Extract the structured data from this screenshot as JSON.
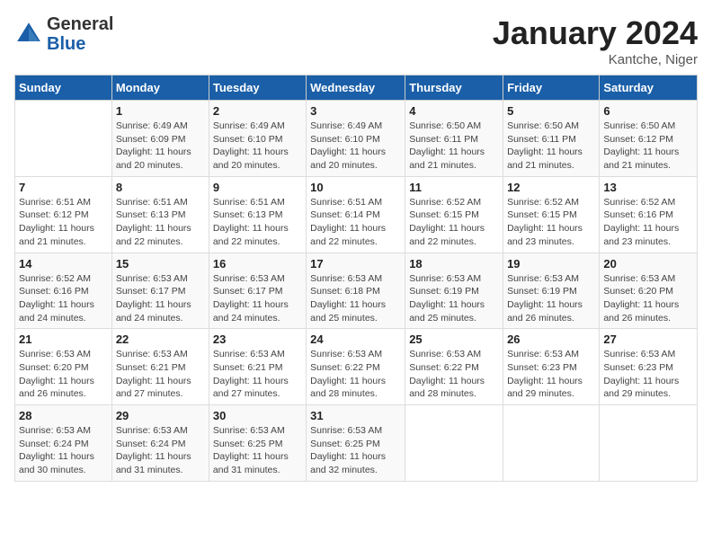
{
  "header": {
    "logo_general": "General",
    "logo_blue": "Blue",
    "month_title": "January 2024",
    "subtitle": "Kantche, Niger"
  },
  "columns": [
    "Sunday",
    "Monday",
    "Tuesday",
    "Wednesday",
    "Thursday",
    "Friday",
    "Saturday"
  ],
  "weeks": [
    [
      {
        "day": "",
        "info": ""
      },
      {
        "day": "1",
        "info": "Sunrise: 6:49 AM\nSunset: 6:09 PM\nDaylight: 11 hours\nand 20 minutes."
      },
      {
        "day": "2",
        "info": "Sunrise: 6:49 AM\nSunset: 6:10 PM\nDaylight: 11 hours\nand 20 minutes."
      },
      {
        "day": "3",
        "info": "Sunrise: 6:49 AM\nSunset: 6:10 PM\nDaylight: 11 hours\nand 20 minutes."
      },
      {
        "day": "4",
        "info": "Sunrise: 6:50 AM\nSunset: 6:11 PM\nDaylight: 11 hours\nand 21 minutes."
      },
      {
        "day": "5",
        "info": "Sunrise: 6:50 AM\nSunset: 6:11 PM\nDaylight: 11 hours\nand 21 minutes."
      },
      {
        "day": "6",
        "info": "Sunrise: 6:50 AM\nSunset: 6:12 PM\nDaylight: 11 hours\nand 21 minutes."
      }
    ],
    [
      {
        "day": "7",
        "info": "Sunrise: 6:51 AM\nSunset: 6:12 PM\nDaylight: 11 hours\nand 21 minutes."
      },
      {
        "day": "8",
        "info": "Sunrise: 6:51 AM\nSunset: 6:13 PM\nDaylight: 11 hours\nand 22 minutes."
      },
      {
        "day": "9",
        "info": "Sunrise: 6:51 AM\nSunset: 6:13 PM\nDaylight: 11 hours\nand 22 minutes."
      },
      {
        "day": "10",
        "info": "Sunrise: 6:51 AM\nSunset: 6:14 PM\nDaylight: 11 hours\nand 22 minutes."
      },
      {
        "day": "11",
        "info": "Sunrise: 6:52 AM\nSunset: 6:15 PM\nDaylight: 11 hours\nand 22 minutes."
      },
      {
        "day": "12",
        "info": "Sunrise: 6:52 AM\nSunset: 6:15 PM\nDaylight: 11 hours\nand 23 minutes."
      },
      {
        "day": "13",
        "info": "Sunrise: 6:52 AM\nSunset: 6:16 PM\nDaylight: 11 hours\nand 23 minutes."
      }
    ],
    [
      {
        "day": "14",
        "info": "Sunrise: 6:52 AM\nSunset: 6:16 PM\nDaylight: 11 hours\nand 24 minutes."
      },
      {
        "day": "15",
        "info": "Sunrise: 6:53 AM\nSunset: 6:17 PM\nDaylight: 11 hours\nand 24 minutes."
      },
      {
        "day": "16",
        "info": "Sunrise: 6:53 AM\nSunset: 6:17 PM\nDaylight: 11 hours\nand 24 minutes."
      },
      {
        "day": "17",
        "info": "Sunrise: 6:53 AM\nSunset: 6:18 PM\nDaylight: 11 hours\nand 25 minutes."
      },
      {
        "day": "18",
        "info": "Sunrise: 6:53 AM\nSunset: 6:19 PM\nDaylight: 11 hours\nand 25 minutes."
      },
      {
        "day": "19",
        "info": "Sunrise: 6:53 AM\nSunset: 6:19 PM\nDaylight: 11 hours\nand 26 minutes."
      },
      {
        "day": "20",
        "info": "Sunrise: 6:53 AM\nSunset: 6:20 PM\nDaylight: 11 hours\nand 26 minutes."
      }
    ],
    [
      {
        "day": "21",
        "info": "Sunrise: 6:53 AM\nSunset: 6:20 PM\nDaylight: 11 hours\nand 26 minutes."
      },
      {
        "day": "22",
        "info": "Sunrise: 6:53 AM\nSunset: 6:21 PM\nDaylight: 11 hours\nand 27 minutes."
      },
      {
        "day": "23",
        "info": "Sunrise: 6:53 AM\nSunset: 6:21 PM\nDaylight: 11 hours\nand 27 minutes."
      },
      {
        "day": "24",
        "info": "Sunrise: 6:53 AM\nSunset: 6:22 PM\nDaylight: 11 hours\nand 28 minutes."
      },
      {
        "day": "25",
        "info": "Sunrise: 6:53 AM\nSunset: 6:22 PM\nDaylight: 11 hours\nand 28 minutes."
      },
      {
        "day": "26",
        "info": "Sunrise: 6:53 AM\nSunset: 6:23 PM\nDaylight: 11 hours\nand 29 minutes."
      },
      {
        "day": "27",
        "info": "Sunrise: 6:53 AM\nSunset: 6:23 PM\nDaylight: 11 hours\nand 29 minutes."
      }
    ],
    [
      {
        "day": "28",
        "info": "Sunrise: 6:53 AM\nSunset: 6:24 PM\nDaylight: 11 hours\nand 30 minutes."
      },
      {
        "day": "29",
        "info": "Sunrise: 6:53 AM\nSunset: 6:24 PM\nDaylight: 11 hours\nand 31 minutes."
      },
      {
        "day": "30",
        "info": "Sunrise: 6:53 AM\nSunset: 6:25 PM\nDaylight: 11 hours\nand 31 minutes."
      },
      {
        "day": "31",
        "info": "Sunrise: 6:53 AM\nSunset: 6:25 PM\nDaylight: 11 hours\nand 32 minutes."
      },
      {
        "day": "",
        "info": ""
      },
      {
        "day": "",
        "info": ""
      },
      {
        "day": "",
        "info": ""
      }
    ]
  ]
}
